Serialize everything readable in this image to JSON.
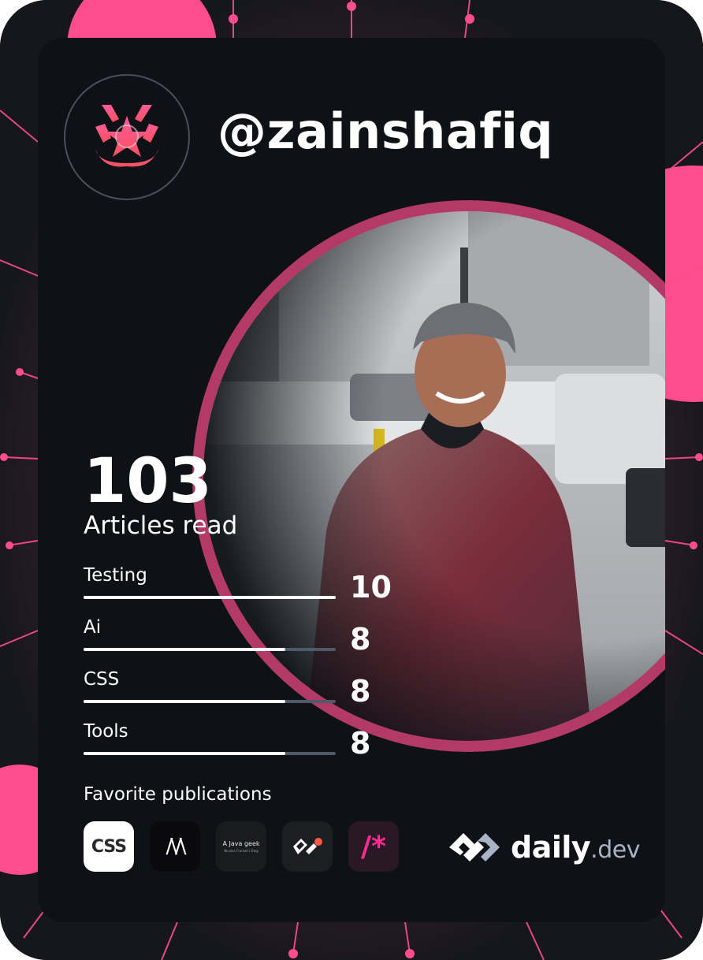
{
  "card": {
    "username": "@zainshafiq",
    "articles_read": "103",
    "articles_label": "Articles read",
    "tags": [
      {
        "name": "Testing",
        "count": "10",
        "progress": 1.0
      },
      {
        "name": "Ai",
        "count": "8",
        "progress": 0.8
      },
      {
        "name": "CSS",
        "count": "8",
        "progress": 0.8
      },
      {
        "name": "Tools",
        "count": "8",
        "progress": 0.8
      }
    ],
    "favorite_label": "Favorite publications",
    "publications": [
      {
        "icon": "css-tricks-icon",
        "text": "CSS"
      },
      {
        "icon": "medium-icon",
        "text": "/\\/\\"
      },
      {
        "icon": "a-java-geek-icon",
        "text": "A Java geek",
        "subtext": "Nicolas Frankel's Blog"
      },
      {
        "icon": "daily-dev-icon",
        "text": ""
      },
      {
        "icon": "asterisk-icon",
        "text": "/*"
      }
    ],
    "brand": {
      "name": "daily",
      "suffix": ".dev"
    },
    "colors": {
      "accent": "#ff4d8d",
      "card_bg": "#0e1116",
      "text": "#ffffff",
      "bar_bg": "#515867"
    }
  }
}
